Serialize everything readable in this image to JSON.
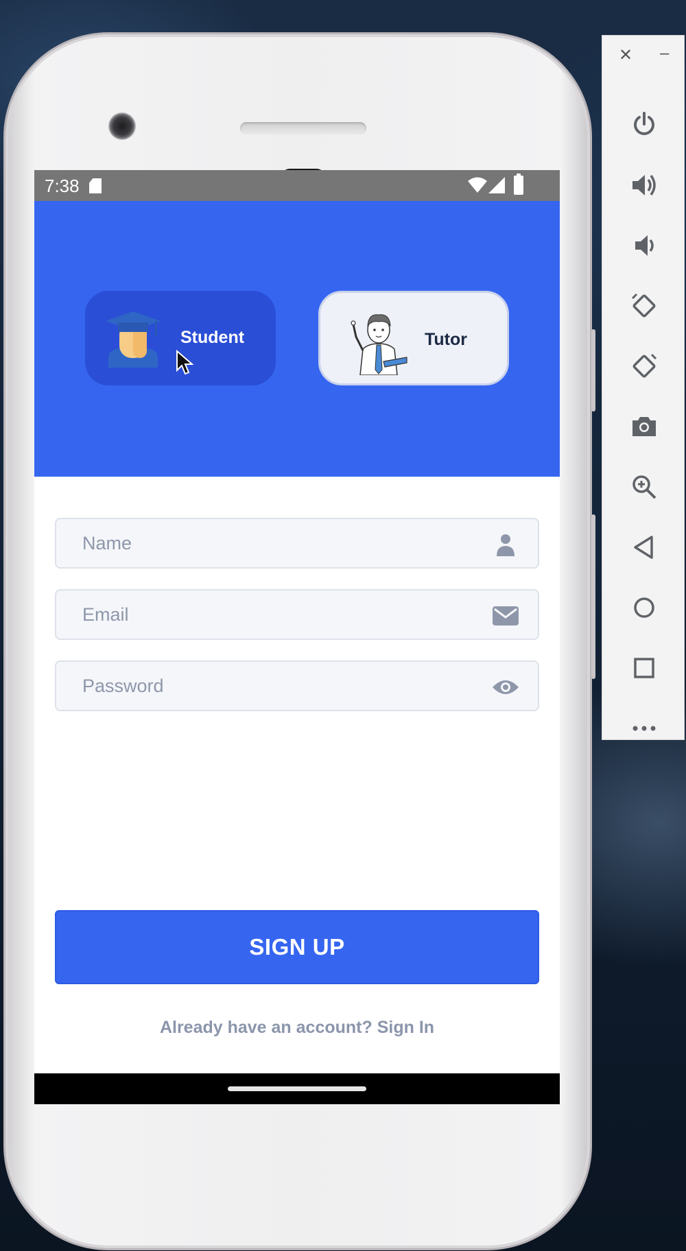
{
  "status_bar": {
    "time": "7:38"
  },
  "roles": {
    "student": {
      "label": "Student",
      "selected": true
    },
    "tutor": {
      "label": "Tutor",
      "selected": false
    }
  },
  "form": {
    "name_placeholder": "Name",
    "email_placeholder": "Email",
    "password_placeholder": "Password"
  },
  "signup_label": "SIGN UP",
  "signin_prompt": "Already have an account? Sign In",
  "colors": {
    "primary": "#3666f0",
    "selected_card": "#2a4ed6",
    "field_bg": "#f5f6fa",
    "muted_text": "#8b95ab"
  },
  "emulator_toolbar": {
    "close": "✕",
    "minimize": "–",
    "buttons": [
      "power-icon",
      "volume-up-icon",
      "volume-down-icon",
      "rotate-left-icon",
      "rotate-right-icon",
      "camera-icon",
      "zoom-icon",
      "back-icon",
      "home-icon",
      "overview-icon",
      "more-icon"
    ]
  }
}
